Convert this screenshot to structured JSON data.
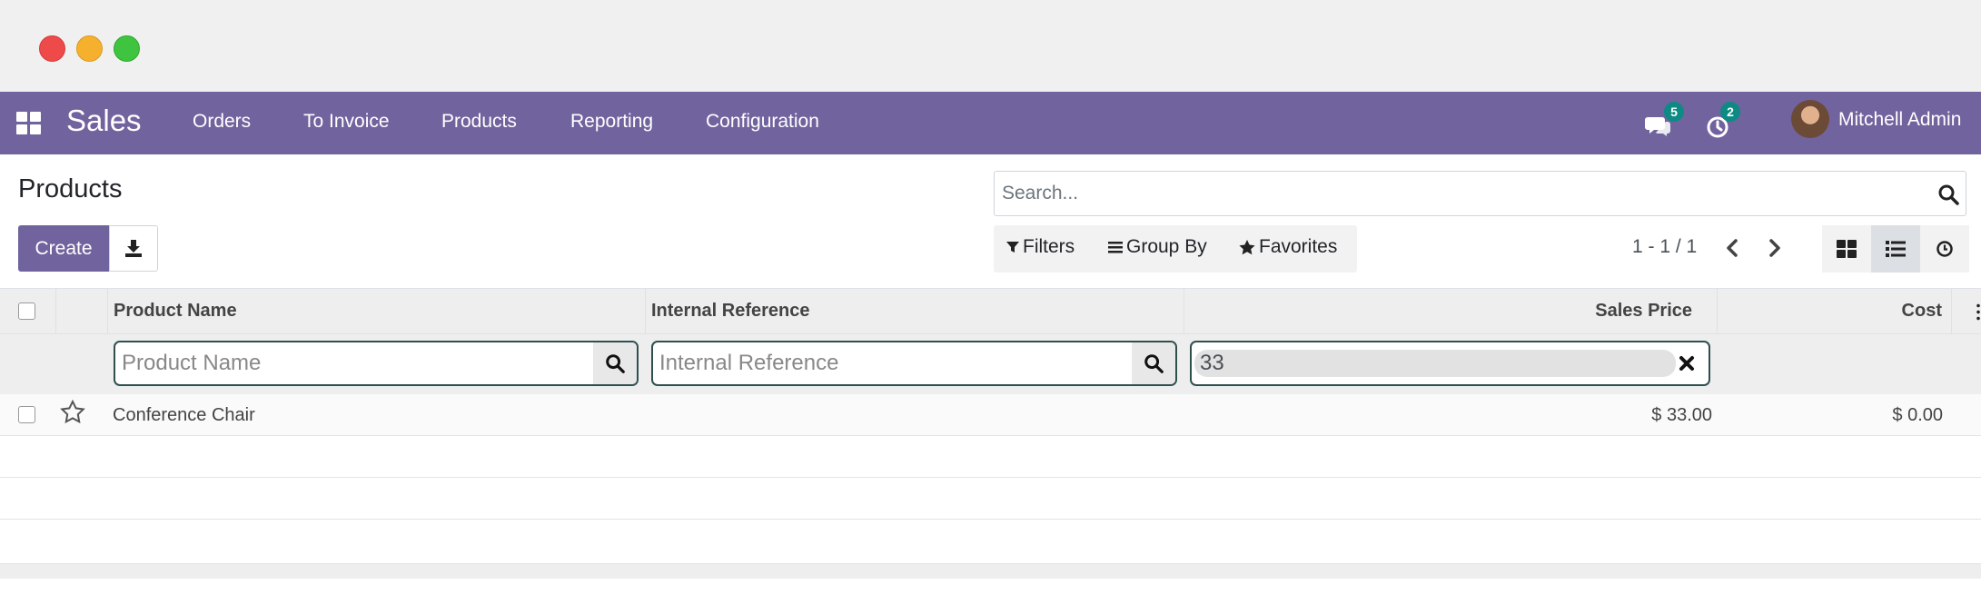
{
  "window": {
    "controls": [
      "close",
      "minimize",
      "maximize"
    ]
  },
  "navbar": {
    "app_name": "Sales",
    "menu": [
      "Orders",
      "To Invoice",
      "Products",
      "Reporting",
      "Configuration"
    ],
    "messages_badge": "5",
    "activities_badge": "2",
    "user_name": "Mitchell Admin"
  },
  "control_panel": {
    "breadcrumb": "Products",
    "create_label": "Create",
    "search_placeholder": "Search...",
    "filters_label": "Filters",
    "group_by_label": "Group By",
    "favorites_label": "Favorites",
    "pager": "1 - 1 / 1"
  },
  "table": {
    "headers": {
      "product_name": "Product Name",
      "internal_reference": "Internal Reference",
      "sales_price": "Sales Price",
      "cost": "Cost"
    },
    "filters": {
      "product_name_placeholder": "Product Name",
      "internal_reference_placeholder": "Internal Reference",
      "sales_price_value": "33"
    },
    "rows": [
      {
        "product_name": "Conference Chair",
        "internal_reference": "",
        "sales_price": "$ 33.00",
        "cost": "$ 0.00"
      }
    ]
  },
  "colors": {
    "brand": "#71639e",
    "badge": "#0d8a84"
  }
}
